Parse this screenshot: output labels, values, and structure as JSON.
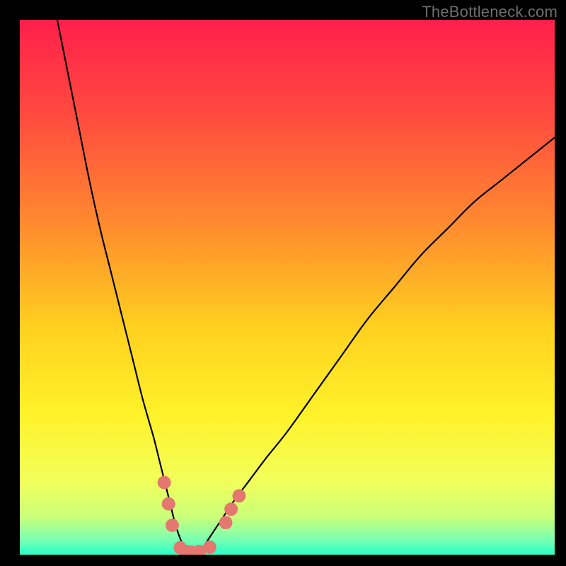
{
  "watermark": "TheBottleneck.com",
  "chart_data": {
    "type": "line",
    "title": "",
    "xlabel": "",
    "ylabel": "",
    "xlim": [
      0,
      100
    ],
    "ylim": [
      0,
      100
    ],
    "grid": false,
    "legend": false,
    "background_gradient": {
      "stops": [
        {
          "offset": 0.0,
          "color": "#ff1f4b"
        },
        {
          "offset": 0.18,
          "color": "#ff4b3f"
        },
        {
          "offset": 0.38,
          "color": "#ff8a2f"
        },
        {
          "offset": 0.58,
          "color": "#ffd21f"
        },
        {
          "offset": 0.74,
          "color": "#fff22a"
        },
        {
          "offset": 0.86,
          "color": "#f3ff5a"
        },
        {
          "offset": 0.93,
          "color": "#c9ff7a"
        },
        {
          "offset": 0.97,
          "color": "#7dffb0"
        },
        {
          "offset": 1.0,
          "color": "#2bffc9"
        }
      ]
    },
    "series": [
      {
        "name": "bottleneck-curve",
        "color": "#000000",
        "x": [
          7,
          9,
          11,
          13,
          15,
          17,
          19,
          21,
          23,
          25,
          26,
          27,
          28,
          29,
          30,
          31,
          32,
          33,
          34,
          35,
          36,
          38,
          40,
          43,
          46,
          50,
          55,
          60,
          65,
          70,
          75,
          80,
          85,
          90,
          95,
          100
        ],
        "y": [
          100,
          90,
          80,
          70,
          61,
          53,
          45,
          37,
          29,
          22,
          18,
          14,
          10,
          6,
          3,
          1,
          0.3,
          0.3,
          1,
          2.5,
          4,
          7,
          10,
          14,
          18,
          23,
          30,
          37,
          44,
          50,
          56,
          61,
          66,
          70,
          74,
          78
        ]
      }
    ],
    "markers": {
      "name": "highlight-dots",
      "color": "#e4776f",
      "radius_pct": 1.25,
      "points": [
        {
          "x": 27.0,
          "y": 13.5
        },
        {
          "x": 27.8,
          "y": 9.5
        },
        {
          "x": 28.5,
          "y": 5.5
        },
        {
          "x": 30.0,
          "y": 1.3
        },
        {
          "x": 31.0,
          "y": 0.6
        },
        {
          "x": 32.0,
          "y": 0.5
        },
        {
          "x": 33.5,
          "y": 0.6
        },
        {
          "x": 35.5,
          "y": 1.4
        },
        {
          "x": 38.5,
          "y": 6.0
        },
        {
          "x": 39.5,
          "y": 8.5
        },
        {
          "x": 41.0,
          "y": 11.0
        }
      ]
    }
  }
}
